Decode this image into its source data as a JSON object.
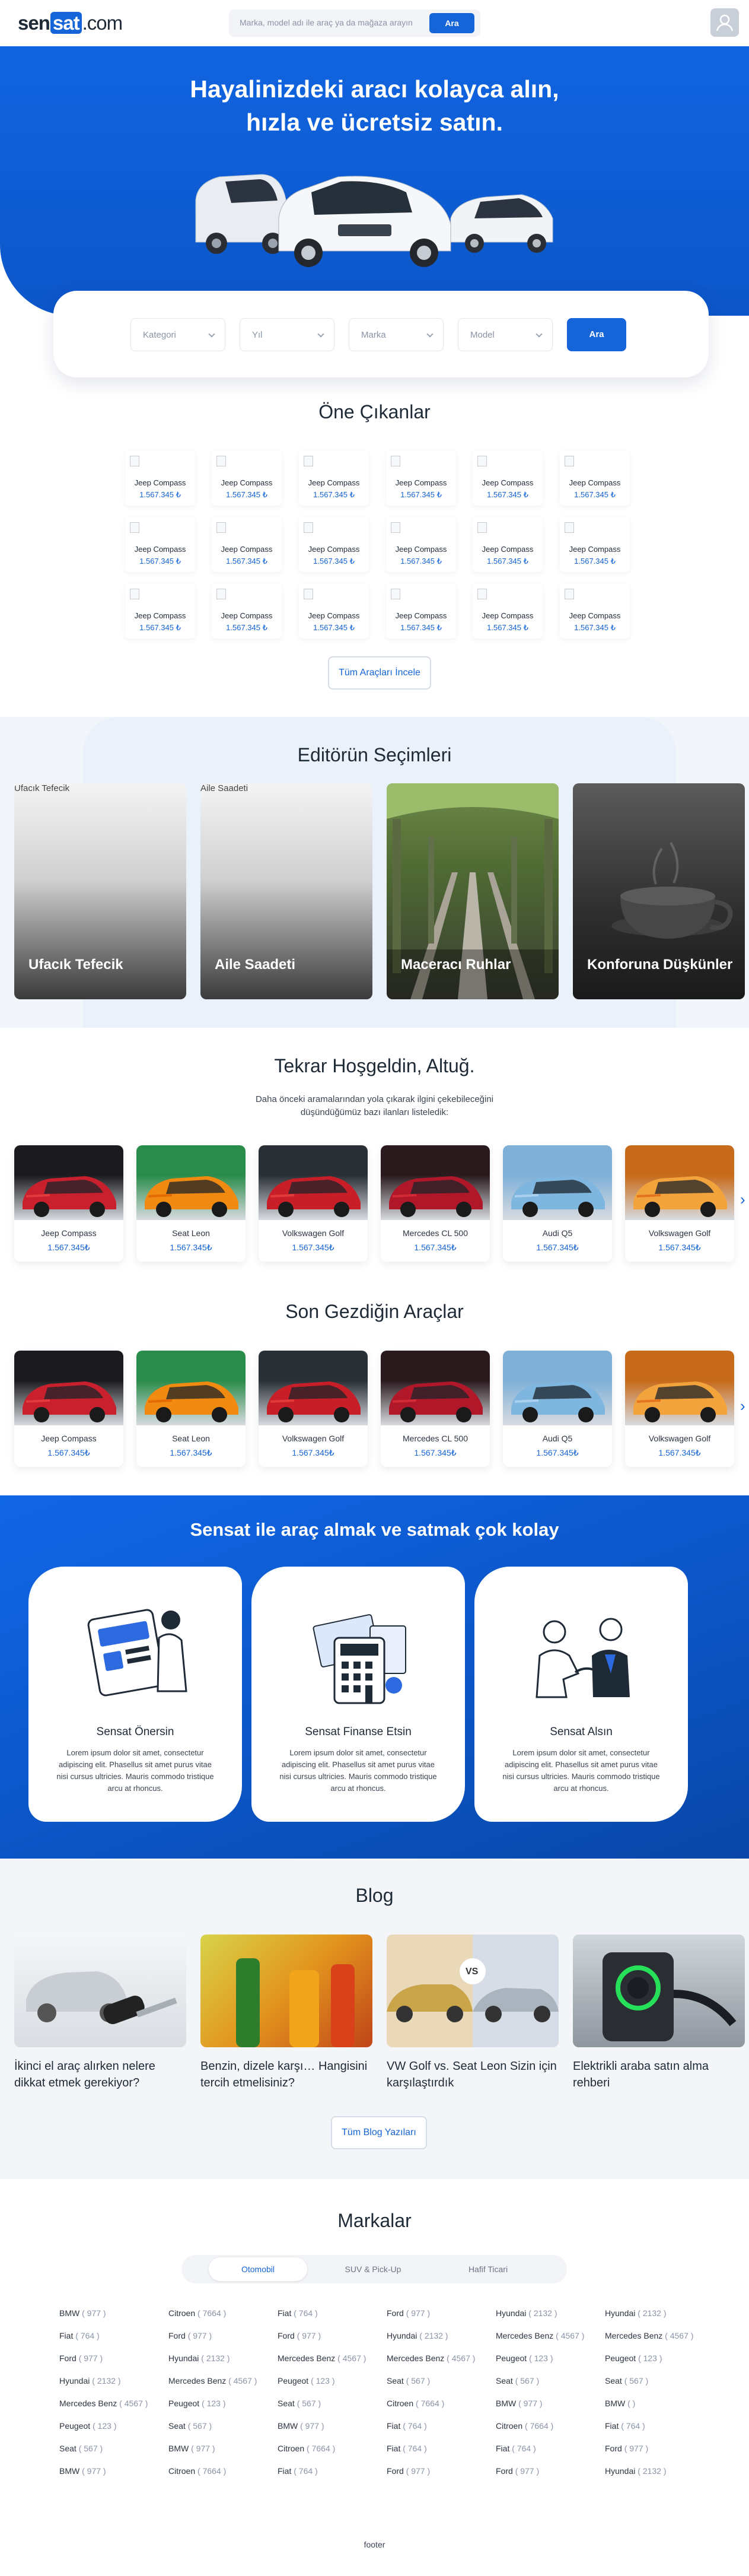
{
  "header": {
    "logo": {
      "a": "sen",
      "b": "sat",
      "c": ".com"
    },
    "search_placeholder": "Marka, model adı ile araç ya da mağaza arayın",
    "search_button": "Ara"
  },
  "hero": {
    "title_line1": "Hayalinizdeki aracı kolayca alın,",
    "title_line2": "hızla ve ücretsiz satın."
  },
  "search_panel": {
    "category": "Kategori",
    "year": "Yıl",
    "brand": "Marka",
    "model": "Model",
    "button": "Ara"
  },
  "featured": {
    "title": "Öne Çıkanlar",
    "items": [
      {
        "name": "Jeep Compass",
        "price": "1.567.345 ₺"
      },
      {
        "name": "Jeep Compass",
        "price": "1.567.345 ₺"
      },
      {
        "name": "Jeep Compass",
        "price": "1.567.345 ₺"
      },
      {
        "name": "Jeep Compass",
        "price": "1.567.345 ₺"
      },
      {
        "name": "Jeep Compass",
        "price": "1.567.345 ₺"
      },
      {
        "name": "Jeep Compass",
        "price": "1.567.345 ₺"
      },
      {
        "name": "Jeep Compass",
        "price": "1.567.345 ₺"
      },
      {
        "name": "Jeep Compass",
        "price": "1.567.345 ₺"
      },
      {
        "name": "Jeep Compass",
        "price": "1.567.345 ₺"
      },
      {
        "name": "Jeep Compass",
        "price": "1.567.345 ₺"
      },
      {
        "name": "Jeep Compass",
        "price": "1.567.345 ₺"
      },
      {
        "name": "Jeep Compass",
        "price": "1.567.345 ₺"
      },
      {
        "name": "Jeep Compass",
        "price": "1.567.345 ₺"
      },
      {
        "name": "Jeep Compass",
        "price": "1.567.345 ₺"
      },
      {
        "name": "Jeep Compass",
        "price": "1.567.345 ₺"
      },
      {
        "name": "Jeep Compass",
        "price": "1.567.345 ₺"
      },
      {
        "name": "Jeep Compass",
        "price": "1.567.345 ₺"
      },
      {
        "name": "Jeep Compass",
        "price": "1.567.345 ₺"
      }
    ],
    "all_button": "Tüm Araçları İncele"
  },
  "editor": {
    "title": "Editörün Seçimleri",
    "items": [
      {
        "title": "Ufacık Tefecik",
        "alt": "Ufacık Tefecik"
      },
      {
        "title": "Aile Saadeti",
        "alt": "Aile Saadeti"
      },
      {
        "title": "Maceracı Ruhlar"
      },
      {
        "title": "Konforuna Düşkünler"
      }
    ]
  },
  "welcome": {
    "title": "Tekrar Hoşgeldin, Altuğ.",
    "subtitle_line1": "Daha önceki aramalarından yola çıkarak ilgini çekebileceğini",
    "subtitle_line2": "düşündüğümüz bazı ilanları listeledik:",
    "cars": [
      {
        "name": "Jeep Compass",
        "price": "1.567.345₺"
      },
      {
        "name": "Seat Leon",
        "price": "1.567.345₺"
      },
      {
        "name": "Volkswagen Golf",
        "price": "1.567.345₺"
      },
      {
        "name": "Mercedes CL 500",
        "price": "1.567.345₺"
      },
      {
        "name": "Audi Q5",
        "price": "1.567.345₺"
      },
      {
        "name": "Volkswagen Golf",
        "price": "1.567.345₺"
      }
    ]
  },
  "recent": {
    "title": "Son Gezdiğin Araçlar",
    "cars": [
      {
        "name": "Jeep Compass",
        "price": "1.567.345₺"
      },
      {
        "name": "Seat Leon",
        "price": "1.567.345₺"
      },
      {
        "name": "Volkswagen Golf",
        "price": "1.567.345₺"
      },
      {
        "name": "Mercedes CL 500",
        "price": "1.567.345₺"
      },
      {
        "name": "Audi Q5",
        "price": "1.567.345₺"
      },
      {
        "name": "Volkswagen Golf",
        "price": "1.567.345₺"
      }
    ]
  },
  "steps": {
    "title": "Sensat ile araç almak ve satmak çok kolay",
    "items": [
      {
        "title": "Sensat Önersin",
        "desc": "Lorem ipsum dolor sit amet, consectetur adipiscing elit. Phasellus sit amet purus vitae nisi cursus ultricies. Mauris commodo tristique arcu at rhoncus."
      },
      {
        "title": "Sensat Finanse Etsin",
        "desc": "Lorem ipsum dolor sit amet, consectetur adipiscing elit. Phasellus sit amet purus vitae nisi cursus ultricies. Mauris commodo tristique arcu at rhoncus."
      },
      {
        "title": "Sensat Alsın",
        "desc": "Lorem ipsum dolor sit amet, consectetur adipiscing elit. Phasellus sit amet purus vitae nisi cursus ultricies. Mauris commodo tristique arcu at rhoncus."
      }
    ]
  },
  "blog": {
    "title": "Blog",
    "vs_badge": "VS",
    "items": [
      {
        "title": "İkinci el araç alırken nelere dikkat etmek gerekiyor?"
      },
      {
        "title": "Benzin, dizele karşı… Hangisini tercih etmelisiniz?"
      },
      {
        "title": "VW Golf vs. Seat Leon Sizin için karşılaştırdık"
      },
      {
        "title": "Elektrikli araba satın alma rehberi"
      }
    ],
    "all_button": "Tüm Blog Yazıları"
  },
  "brands": {
    "title": "Markalar",
    "tabs": [
      "Otomobil",
      "SUV & Pick-Up",
      "Hafif Ticari"
    ],
    "columns": [
      [
        {
          "n": "BMW",
          "c": "( 977 )"
        },
        {
          "n": "Fiat",
          "c": "( 764 )"
        },
        {
          "n": "Ford",
          "c": "( 977 )"
        },
        {
          "n": "Hyundai",
          "c": "( 2132 )"
        },
        {
          "n": "Mercedes Benz",
          "c": "( 4567 )"
        },
        {
          "n": "Peugeot",
          "c": "( 123 )"
        },
        {
          "n": "Seat",
          "c": "( 567 )"
        },
        {
          "n": "BMW",
          "c": "( 977 )"
        }
      ],
      [
        {
          "n": "Citroen",
          "c": "( 7664 )"
        },
        {
          "n": "Ford",
          "c": "( 977 )"
        },
        {
          "n": "Hyundai",
          "c": "( 2132 )"
        },
        {
          "n": "Mercedes Benz",
          "c": "( 4567 )"
        },
        {
          "n": "Peugeot",
          "c": "( 123 )"
        },
        {
          "n": "Seat",
          "c": "( 567 )"
        },
        {
          "n": "BMW",
          "c": "( 977 )"
        },
        {
          "n": "Citroen",
          "c": "( 7664 )"
        }
      ],
      [
        {
          "n": "Fiat",
          "c": "( 764 )"
        },
        {
          "n": "Ford",
          "c": "( 977 )"
        },
        {
          "n": "Mercedes Benz",
          "c": "( 4567 )"
        },
        {
          "n": "Peugeot",
          "c": "( 123 )"
        },
        {
          "n": "Seat",
          "c": "( 567 )"
        },
        {
          "n": "BMW",
          "c": "( 977 )"
        },
        {
          "n": "Citroen",
          "c": "( 7664 )"
        },
        {
          "n": "Fiat",
          "c": "( 764 )"
        }
      ],
      [
        {
          "n": "Ford",
          "c": "( 977 )"
        },
        {
          "n": "Hyundai",
          "c": "( 2132 )"
        },
        {
          "n": "Mercedes Benz",
          "c": "( 4567 )"
        },
        {
          "n": "Seat",
          "c": "( 567 )"
        },
        {
          "n": "Citroen",
          "c": "( 7664 )"
        },
        {
          "n": "Fiat",
          "c": "( 764 )"
        },
        {
          "n": "Fiat",
          "c": "( 764 )"
        },
        {
          "n": "Ford",
          "c": "( 977 )"
        }
      ],
      [
        {
          "n": "Hyundai",
          "c": "( 2132 )"
        },
        {
          "n": "Mercedes Benz",
          "c": "( 4567 )"
        },
        {
          "n": "Peugeot",
          "c": "( 123 )"
        },
        {
          "n": "Seat",
          "c": "( 567 )"
        },
        {
          "n": "BMW",
          "c": "( 977 )"
        },
        {
          "n": "Citroen",
          "c": "( 7664 )"
        },
        {
          "n": "Fiat",
          "c": "( 764 )"
        },
        {
          "n": "Ford",
          "c": "( 977 )"
        }
      ],
      [
        {
          "n": "Hyundai",
          "c": "( 2132 )"
        },
        {
          "n": "Mercedes Benz",
          "c": "( 4567 )"
        },
        {
          "n": "Peugeot",
          "c": "( 123 )"
        },
        {
          "n": "Seat",
          "c": "( 567 )"
        },
        {
          "n": "BMW",
          "c": "( )"
        },
        {
          "n": "Fiat",
          "c": "( 764 )"
        },
        {
          "n": "Ford",
          "c": "( 977 )"
        },
        {
          "n": "Hyundai",
          "c": "( 2132 )"
        }
      ]
    ]
  },
  "footer": {
    "text": "footer"
  },
  "colors": {
    "brand": "#1565d8",
    "hero": "#1164e0",
    "text": "#1f2a37"
  }
}
